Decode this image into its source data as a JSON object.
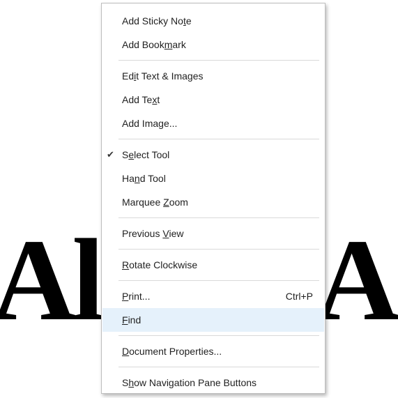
{
  "background_document": {
    "left_text": "Al",
    "right_text": "A"
  },
  "context_menu": {
    "groups": [
      {
        "items": [
          {
            "label_pre": "Add Sticky No",
            "accel": "t",
            "label_post": "e"
          },
          {
            "label_pre": "Add Book",
            "accel": "m",
            "label_post": "ark"
          }
        ]
      },
      {
        "items": [
          {
            "label_pre": "Ed",
            "accel": "i",
            "label_post": "t Text & Images"
          },
          {
            "label_pre": "Add Te",
            "accel": "x",
            "label_post": "t"
          },
          {
            "label_pre": "Add Ima",
            "accel": "g",
            "label_post": "e..."
          }
        ]
      },
      {
        "items": [
          {
            "label_pre": "S",
            "accel": "e",
            "label_post": "lect Tool",
            "checked": true,
            "check_glyph": "✔"
          },
          {
            "label_pre": "Ha",
            "accel": "n",
            "label_post": "d Tool"
          },
          {
            "label_pre": "Marquee ",
            "accel": "Z",
            "label_post": "oom"
          }
        ]
      },
      {
        "items": [
          {
            "label_pre": "Previous ",
            "accel": "V",
            "label_post": "iew"
          }
        ]
      },
      {
        "items": [
          {
            "label_pre": "",
            "accel": "R",
            "label_post": "otate Clockwise"
          }
        ]
      },
      {
        "items": [
          {
            "label_pre": "",
            "accel": "P",
            "label_post": "rint...",
            "shortcut": "Ctrl+P"
          },
          {
            "label_pre": "",
            "accel": "F",
            "label_post": "ind",
            "highlighted": true
          }
        ]
      },
      {
        "items": [
          {
            "label_pre": "",
            "accel": "D",
            "label_post": "ocument Properties..."
          }
        ]
      },
      {
        "items": [
          {
            "label_pre": "S",
            "accel": "h",
            "label_post": "ow Navigation Pane Buttons"
          }
        ]
      }
    ],
    "highlight_color": "#e5f1fb"
  }
}
